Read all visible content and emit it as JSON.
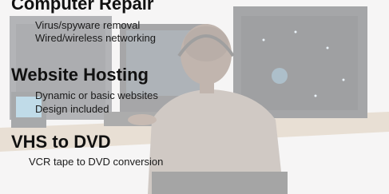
{
  "banner": {
    "sections": [
      {
        "heading": "Computer Repair",
        "items": [
          "Virus/spyware removal",
          "Wired/wireless networking"
        ]
      },
      {
        "heading": "Website Hosting",
        "items": [
          "Dynamic or basic websites",
          "Design included"
        ]
      },
      {
        "heading": "VHS to DVD",
        "items": [
          "VCR tape to DVD conversion"
        ]
      }
    ]
  },
  "colors": {
    "heading": "#111111",
    "text": "#1a1a1a",
    "veil": "#ffffff"
  }
}
